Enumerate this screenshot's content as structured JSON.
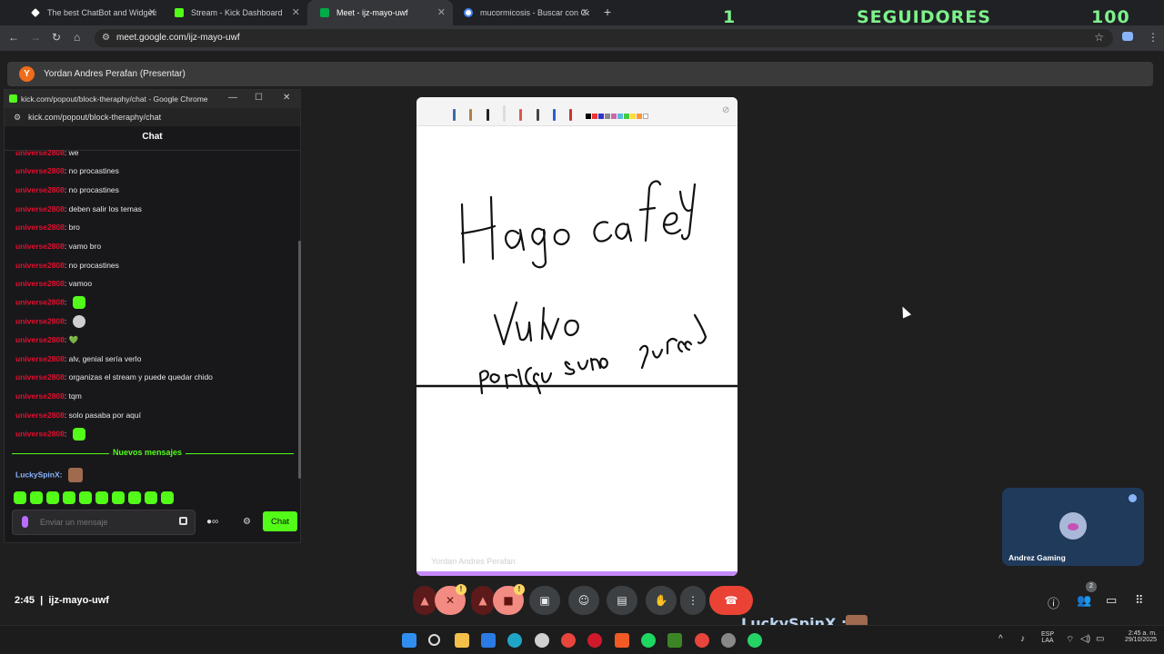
{
  "browser": {
    "tabs": [
      {
        "label": "The best ChatBot and Widgets",
        "icon": "diamond-icon",
        "color": "#ffffff"
      },
      {
        "label": "Stream - Kick Dashboard",
        "icon": "kick-icon",
        "color": "#53fc18"
      },
      {
        "label": "Meet - ijz-mayo-uwf",
        "icon": "meet-icon",
        "color": "#00ac47",
        "active": true
      },
      {
        "label": "mucormicosis - Buscar con Goo",
        "icon": "google-icon",
        "color": "#4285f4"
      }
    ],
    "url": "meet.google.com/ijz-mayo-uwf"
  },
  "overlay": {
    "left": "1",
    "label": "SEGUIDORES",
    "right": "100"
  },
  "present_bar": {
    "avatar_letter": "Y",
    "text": "Yordan Andres Perafan (Presentar)"
  },
  "popup": {
    "title": "kick.com/popout/block-theraphy/chat - Google Chrome",
    "url": "kick.com/popout/block-theraphy/chat",
    "header": "Chat",
    "messages": [
      {
        "user": "universe2808",
        "text": "we"
      },
      {
        "user": "universe2808",
        "text": "no procastines"
      },
      {
        "user": "universe2808",
        "text": "no procastines"
      },
      {
        "user": "universe2808",
        "text": "deben salir los temas"
      },
      {
        "user": "universe2808",
        "text": "bro"
      },
      {
        "user": "universe2808",
        "text": "vamo bro"
      },
      {
        "user": "universe2808",
        "text": "no procastines"
      },
      {
        "user": "universe2808",
        "text": "vamoo"
      },
      {
        "user": "universe2808",
        "text": ""
      },
      {
        "user": "universe2808",
        "text": ""
      },
      {
        "user": "universe2808",
        "text": "💚"
      },
      {
        "user": "universe2808",
        "text": "alv, genial sería verlo"
      },
      {
        "user": "universe2808",
        "text": "organizas el stream y puede quedar chido"
      },
      {
        "user": "universe2808",
        "text": "tqm"
      },
      {
        "user": "universe2808",
        "text": "solo pasaba por aquí"
      },
      {
        "user": "universe2808",
        "text": ""
      }
    ],
    "new_messages_label": "Nuevos mensajes",
    "pending_user": "LuckySpinX",
    "input_placeholder": "Enviar un mensaje",
    "send_label": "Chat"
  },
  "whiteboard": {
    "watermark": "Yordan Andres Perafan",
    "handwriting": [
      "Hago cafe y",
      "Vuelvo",
      "por:(qu sueño pure)"
    ]
  },
  "tile": {
    "name": "Andrez Gaming"
  },
  "meet": {
    "time": "2:45",
    "code": "ijz-mayo-uwf",
    "people_count": "2"
  },
  "stream_overlay": {
    "name": "LuckySpinX :"
  },
  "taskbar": {
    "lang": "ESP",
    "layout": "LAA",
    "time": "2:45 a. m.",
    "date": "29/10/2025"
  }
}
